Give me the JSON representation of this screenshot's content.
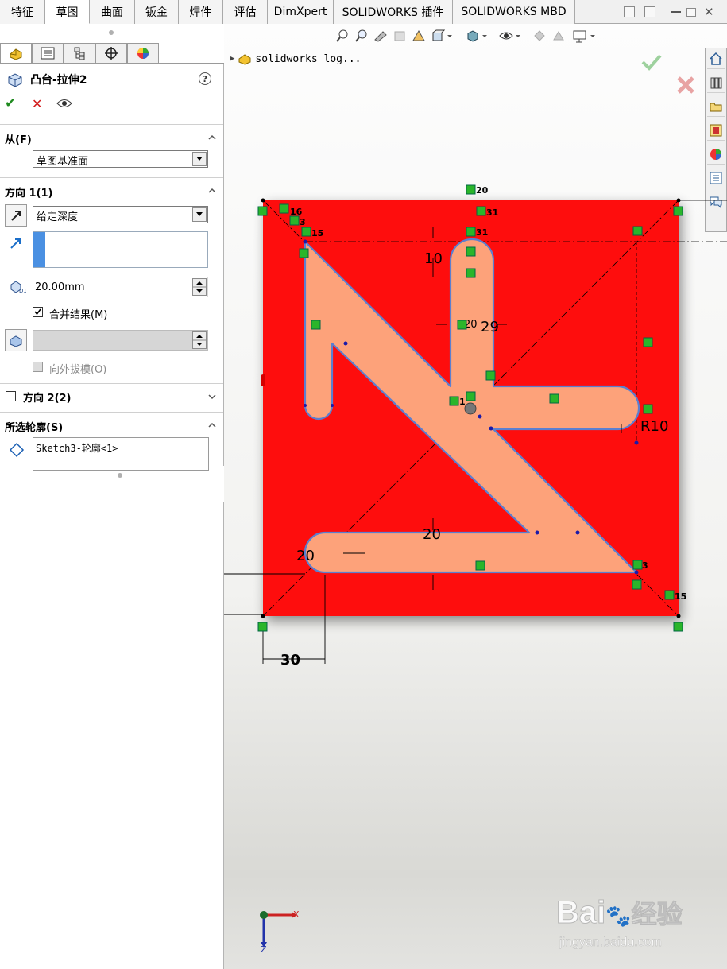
{
  "tabs": [
    {
      "label": "特征"
    },
    {
      "label": "草图"
    },
    {
      "label": "曲面"
    },
    {
      "label": "钣金"
    },
    {
      "label": "焊件"
    },
    {
      "label": "评估"
    },
    {
      "label": "DimXpert"
    },
    {
      "label": "SOLIDWORKS 插件"
    },
    {
      "label": "SOLIDWORKS MBD"
    }
  ],
  "active_tab": "草图",
  "property_manager": {
    "title": "凸台-拉伸2",
    "help_icon": "?",
    "from": {
      "label": "从(F)",
      "value": "草图基准面"
    },
    "direction1": {
      "label": "方向 1(1)",
      "end_condition": "给定深度",
      "depth": "20.00mm",
      "merge_label": "合并结果(M)",
      "merge_checked": true,
      "draft_label": "向外拔模(O)",
      "draft_checked": false
    },
    "direction2": {
      "label": "方向 2(2)",
      "checked": false
    },
    "contours": {
      "label": "所选轮廓(S)",
      "item": "Sketch3-轮廓<1>"
    }
  },
  "feature_tree": {
    "root_label": "solidworks log..."
  },
  "dimensions": {
    "d_top_10": "10",
    "d_width_20": "20",
    "d_29": "29",
    "d_r10": "R10",
    "d_bottom_20": "20",
    "d_left_20": "20",
    "d_30": "30"
  },
  "relations": {
    "r20_top": "20",
    "r16": "16",
    "r3_tl": "3",
    "r15_tl": "15",
    "r31_a": "31",
    "r31_b": "31",
    "r20_mid": "20",
    "r1": "1",
    "r3_br": "3",
    "r15_br": "15"
  },
  "triad": {
    "x": "X",
    "z": "Z"
  },
  "watermark": {
    "brand": "Bai",
    "brand2": "经验",
    "url": "jingyan.baidu.com"
  },
  "colors": {
    "plate": "#fe0f10",
    "profile_fill": "#fda27a",
    "profile_edge": "#5b7fd0",
    "relation": "#2ab52a"
  }
}
